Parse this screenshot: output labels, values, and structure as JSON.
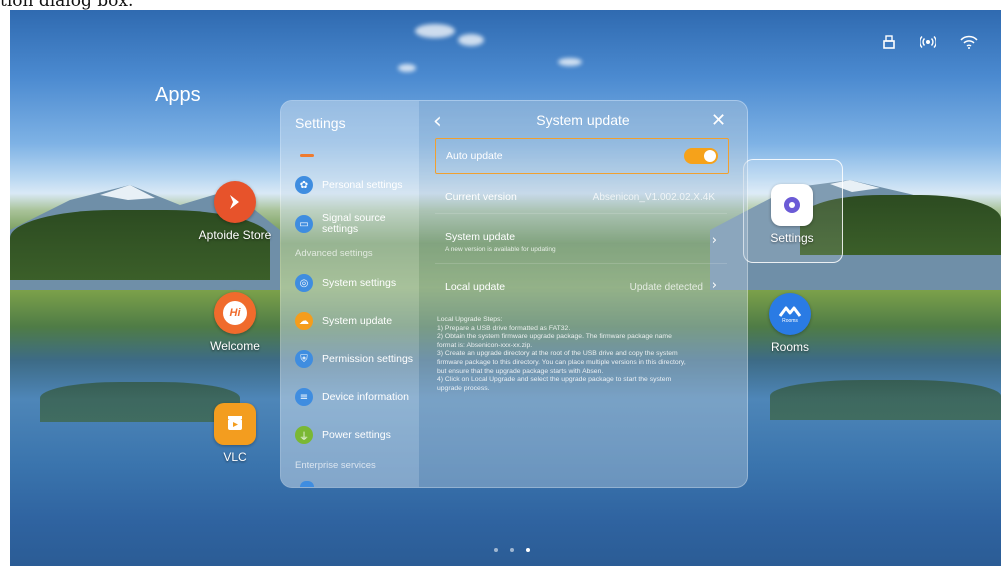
{
  "caption_fragment": "tion dialog box.",
  "home": {
    "title": "Apps",
    "apps": [
      {
        "label": "Aptoide Store",
        "icon": "aptoide-icon",
        "color": "#e7532b"
      },
      {
        "label": "Welcome",
        "icon": "welcome-icon",
        "color": "#f06b2c",
        "glyph": "Hi"
      },
      {
        "label": "VLC",
        "icon": "vlc-icon",
        "color": "#f39d1f"
      },
      {
        "label": "Settings",
        "icon": "gear-icon",
        "color": "#6b5bd6"
      },
      {
        "label": "Rooms",
        "icon": "rooms-icon",
        "color": "#2a7be4",
        "badge": "Rooms"
      }
    ],
    "status_icons": [
      "usb-icon",
      "hotspot-icon",
      "wifi-icon"
    ],
    "page_dots": 3,
    "active_page": 3
  },
  "settings_panel": {
    "title": "Settings",
    "menu_items": [
      {
        "label": "Personal settings",
        "icon": "personal-settings-icon",
        "color": "#3f8de0"
      },
      {
        "label": "Signal source settings",
        "icon": "signal-source-icon",
        "color": "#3f8de0"
      },
      {
        "label": "System settings",
        "icon": "system-settings-icon",
        "color": "#3f8de0"
      },
      {
        "label": "System update",
        "icon": "system-update-icon",
        "color": "#f59d1c"
      },
      {
        "label": "Permission settings",
        "icon": "permission-shield-icon",
        "color": "#3f8de0"
      },
      {
        "label": "Device information",
        "icon": "device-info-icon",
        "color": "#3f8de0"
      },
      {
        "label": "Power settings",
        "icon": "power-plug-icon",
        "color": "#7ab834"
      }
    ],
    "section_labels": {
      "advanced": "Advanced settings",
      "enterprise": "Enterprise services"
    },
    "accent_color": "#ef7b2f"
  },
  "system_update": {
    "title": "System update",
    "auto_update": {
      "label": "Auto update",
      "enabled": true
    },
    "current_version": {
      "label": "Current version",
      "value": "Absenicon_V1.002.02.X.4K"
    },
    "system_update_row": {
      "label": "System update",
      "subtitle": "A new version is available for updating"
    },
    "local_update": {
      "label": "Local update",
      "value": "Update detected"
    },
    "steps": [
      "Local Upgrade Steps:",
      " 1) Prepare a USB drive formatted as FAT32.",
      " 2) Obtain the system firmware upgrade package. The firmware package name",
      "format is: Absenicon-xxx-xx.zip.",
      " 3) Create an upgrade directory at the root of the USB drive and copy the system",
      "firmware package to this directory. You can place multiple versions in this directory,",
      "but ensure that the upgrade package starts with Absen.",
      " 4) Click on Local Upgrade and select the upgrade package to start the system",
      "upgrade process."
    ],
    "toggle_color": "#f6a21a",
    "highlight_color": "#f0a030"
  }
}
